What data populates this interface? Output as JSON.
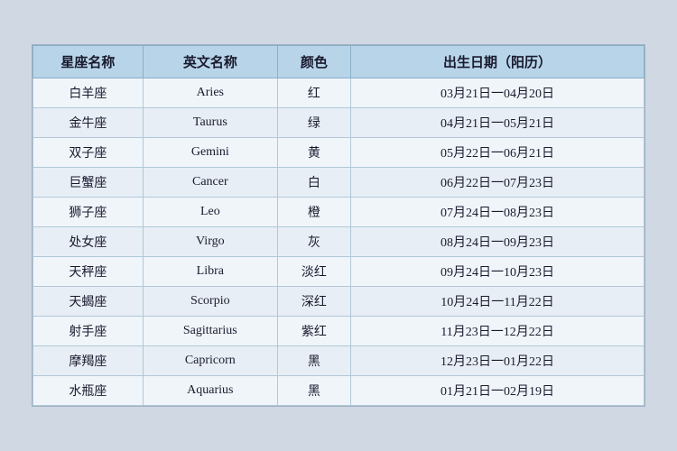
{
  "table": {
    "headers": {
      "cn_name": "星座名称",
      "en_name": "英文名称",
      "color": "颜色",
      "date": "出生日期（阳历）"
    },
    "rows": [
      {
        "cn": "白羊座",
        "en": "Aries",
        "color": "红",
        "date": "03月21日一04月20日"
      },
      {
        "cn": "金牛座",
        "en": "Taurus",
        "color": "绿",
        "date": "04月21日一05月21日"
      },
      {
        "cn": "双子座",
        "en": "Gemini",
        "color": "黄",
        "date": "05月22日一06月21日"
      },
      {
        "cn": "巨蟹座",
        "en": "Cancer",
        "color": "白",
        "date": "06月22日一07月23日"
      },
      {
        "cn": "狮子座",
        "en": "Leo",
        "color": "橙",
        "date": "07月24日一08月23日"
      },
      {
        "cn": "处女座",
        "en": "Virgo",
        "color": "灰",
        "date": "08月24日一09月23日"
      },
      {
        "cn": "天秤座",
        "en": "Libra",
        "color": "淡红",
        "date": "09月24日一10月23日"
      },
      {
        "cn": "天蝎座",
        "en": "Scorpio",
        "color": "深红",
        "date": "10月24日一11月22日"
      },
      {
        "cn": "射手座",
        "en": "Sagittarius",
        "color": "紫红",
        "date": "11月23日一12月22日"
      },
      {
        "cn": "摩羯座",
        "en": "Capricorn",
        "color": "黑",
        "date": "12月23日一01月22日"
      },
      {
        "cn": "水瓶座",
        "en": "Aquarius",
        "color": "黑",
        "date": "01月21日一02月19日"
      }
    ]
  }
}
